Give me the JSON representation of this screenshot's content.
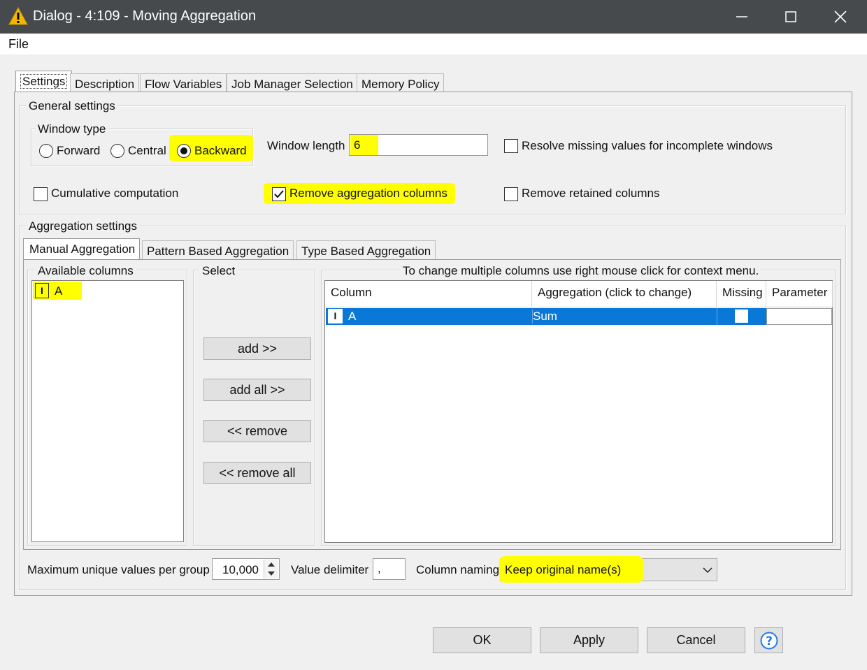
{
  "window": {
    "title": "Dialog - 4:109 - Moving Aggregation",
    "controls": [
      "minimize",
      "maximize",
      "close"
    ]
  },
  "menu": {
    "file": "File"
  },
  "tabs": [
    "Settings",
    "Description",
    "Flow Variables",
    "Job Manager Selection",
    "Memory Policy"
  ],
  "general": {
    "title": "General settings",
    "window_type": {
      "title": "Window type",
      "options": [
        "Forward",
        "Central",
        "Backward"
      ],
      "selected": "Backward"
    },
    "window_length_label": "Window length",
    "window_length_value": "6",
    "resolve_missing_label": "Resolve missing values for incomplete windows",
    "resolve_missing_checked": false,
    "cumulative_label": "Cumulative computation",
    "cumulative_checked": false,
    "remove_agg_label": "Remove aggregation columns",
    "remove_agg_checked": true,
    "remove_retained_label": "Remove retained columns",
    "remove_retained_checked": false
  },
  "aggregation": {
    "title": "Aggregation settings",
    "subtabs": [
      "Manual Aggregation",
      "Pattern Based Aggregation",
      "Type Based Aggregation"
    ],
    "available_title": "Available columns",
    "available_columns": [
      {
        "type": "I",
        "name": "A"
      }
    ],
    "select_title": "Select",
    "buttons": {
      "add": "add >>",
      "add_all": "add all >>",
      "remove": "<< remove",
      "remove_all": "<< remove all"
    },
    "table_title": "To change multiple columns use right mouse click for context menu.",
    "table_headers": [
      "Column",
      "Aggregation (click to change)",
      "Missing",
      "Parameter"
    ],
    "rows": [
      {
        "type": "I",
        "column": "A",
        "aggregation": "Sum",
        "missing": false,
        "parameter": ""
      }
    ]
  },
  "bottom": {
    "max_unique_label": "Maximum unique values per group",
    "max_unique_value": "10,000",
    "delimiter_label": "Value delimiter",
    "delimiter_value": ",",
    "naming_label": "Column naming",
    "naming_value": "Keep original name(s)"
  },
  "footer": {
    "ok": "OK",
    "apply": "Apply",
    "cancel": "Cancel"
  },
  "colors": {
    "highlight": "#ffff00",
    "selection": "#0a78d7",
    "titlebar": "#474a4c"
  }
}
